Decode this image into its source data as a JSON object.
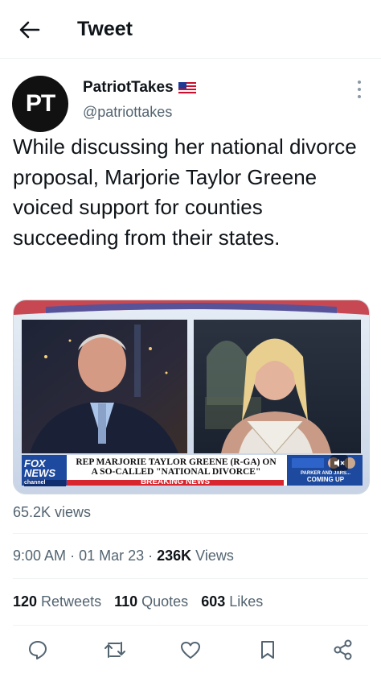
{
  "header": {
    "title": "Tweet"
  },
  "author": {
    "avatar_text": "PT",
    "name": "PatriotTakes",
    "handle": "@patriottakes"
  },
  "tweet": {
    "text": "While discussing her national divorce proposal, Marjorie Taylor Greene voiced support for counties succeeding from their states."
  },
  "media": {
    "lower_third_line1": "REP MARJORIE TAYLOR GREENE (R-GA) ON",
    "lower_third_line2": "A SO-CALLED \"NATIONAL DIVORCE\"",
    "breaking_banner": "BREAKING NEWS",
    "network_logo": "FOX NEWS",
    "network_sub": "channel",
    "promo_line1": "PARKER AND JARS...",
    "promo_line2": "COMING UP"
  },
  "views_line": "65.2K views",
  "meta": {
    "time": "9:00 AM",
    "date": "01 Mar 23",
    "views_count": "236K",
    "views_label": "Views"
  },
  "stats": {
    "retweets_count": "120",
    "retweets_label": "Retweets",
    "quotes_count": "110",
    "quotes_label": "Quotes",
    "likes_count": "603",
    "likes_label": "Likes"
  },
  "icons": [
    "back-arrow-icon",
    "flag-icon",
    "more-icon",
    "reply-icon",
    "retweet-icon",
    "like-icon",
    "bookmark-icon",
    "share-icon"
  ],
  "colors": {
    "text": "#0f1419",
    "secondary": "#536471",
    "divider": "#eff3f4",
    "fox_red": "#d7262e",
    "fox_blue": "#1d4a9f"
  }
}
